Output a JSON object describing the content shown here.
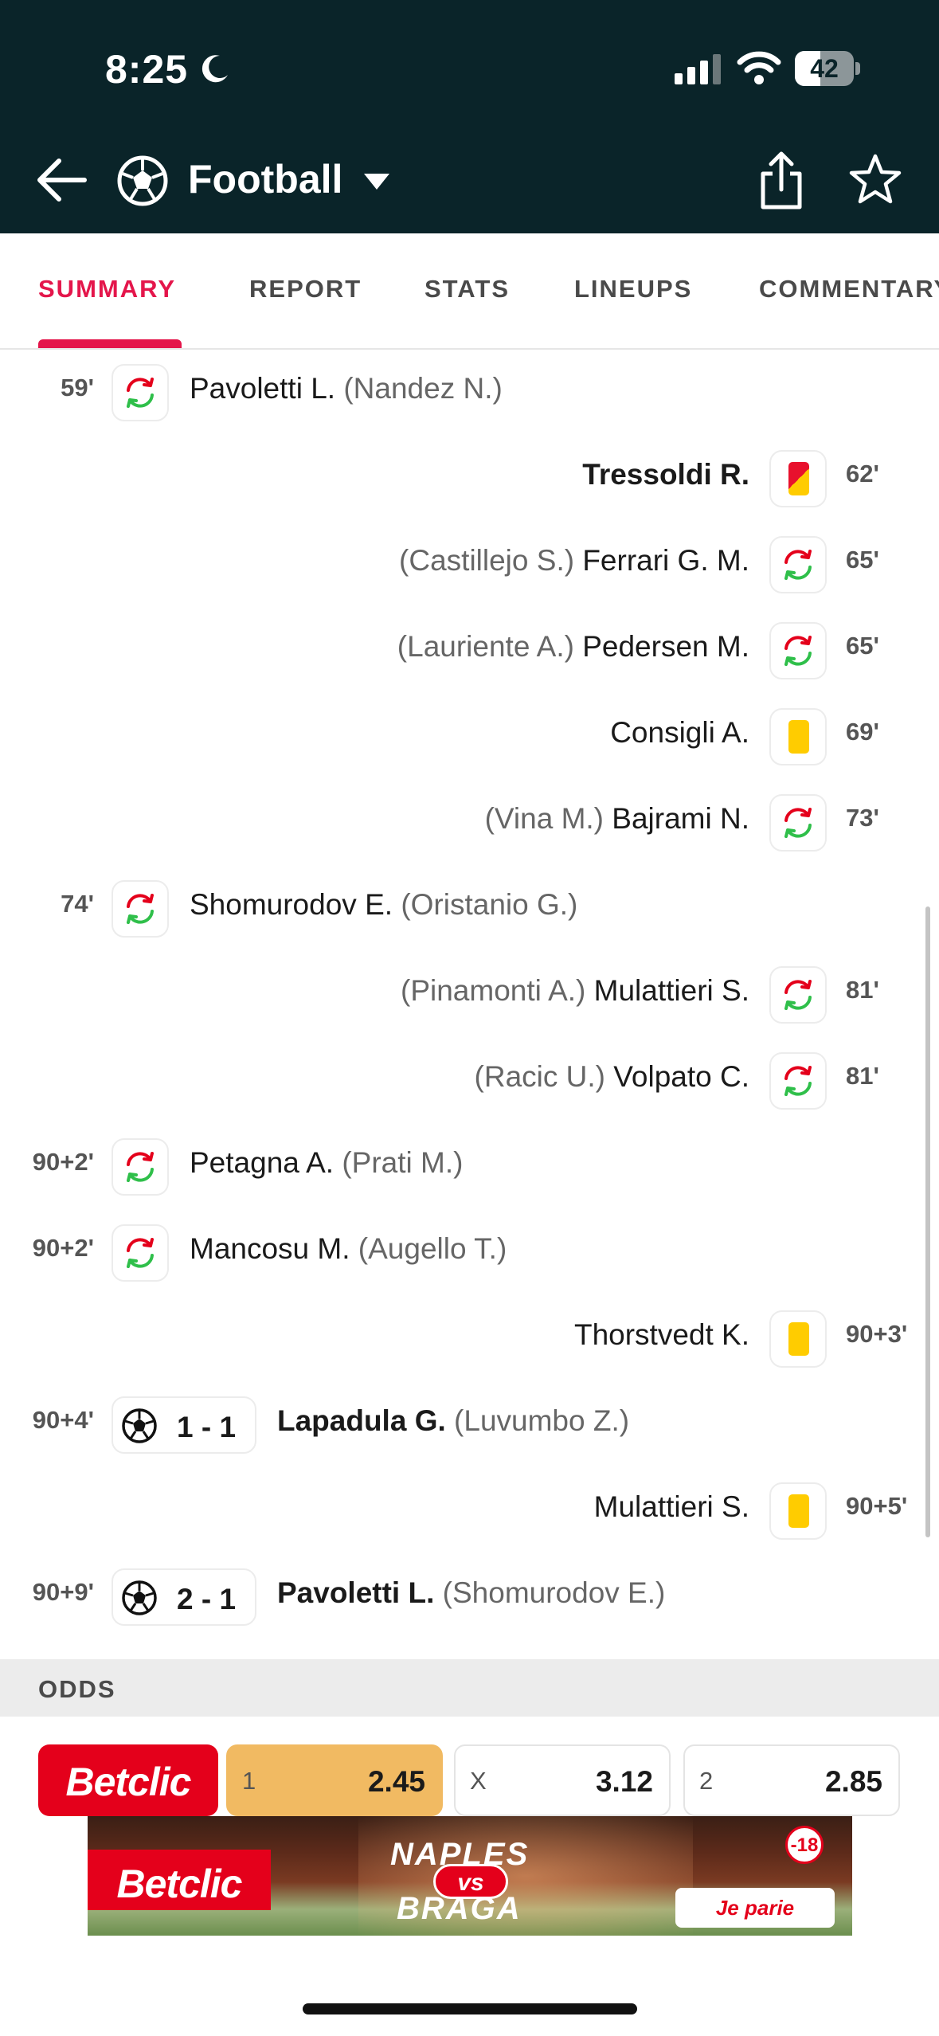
{
  "status_bar": {
    "time": "8:25",
    "battery": "42"
  },
  "header": {
    "title": "Football"
  },
  "tabs": [
    {
      "label": "SUMMARY"
    },
    {
      "label": "REPORT"
    },
    {
      "label": "STATS"
    },
    {
      "label": "LINEUPS"
    },
    {
      "label": "COMMENTARY"
    }
  ],
  "events": [
    {
      "side": "left",
      "type": "substitution",
      "minute": "59'",
      "player": "Pavoletti L.",
      "sub": "(Nandez N.)"
    },
    {
      "side": "right",
      "type": "second-yellow",
      "minute": "62'",
      "player": "Tressoldi R.",
      "sub": ""
    },
    {
      "side": "right",
      "type": "substitution",
      "minute": "65'",
      "player": "Ferrari G. M.",
      "sub": "(Castillejo S.)"
    },
    {
      "side": "right",
      "type": "substitution",
      "minute": "65'",
      "player": "Pedersen M.",
      "sub": "(Lauriente A.)"
    },
    {
      "side": "right",
      "type": "yellow-card",
      "minute": "69'",
      "player": "Consigli A.",
      "sub": ""
    },
    {
      "side": "right",
      "type": "substitution",
      "minute": "73'",
      "player": "Bajrami N.",
      "sub": "(Vina M.)"
    },
    {
      "side": "left",
      "type": "substitution",
      "minute": "74'",
      "player": "Shomurodov E.",
      "sub": "(Oristanio G.)"
    },
    {
      "side": "right",
      "type": "substitution",
      "minute": "81'",
      "player": "Mulattieri S.",
      "sub": "(Pinamonti A.)"
    },
    {
      "side": "right",
      "type": "substitution",
      "minute": "81'",
      "player": "Volpato C.",
      "sub": "(Racic U.)"
    },
    {
      "side": "left",
      "type": "substitution",
      "minute": "90+2'",
      "player": "Petagna A.",
      "sub": "(Prati M.)"
    },
    {
      "side": "left",
      "type": "substitution",
      "minute": "90+2'",
      "player": "Mancosu M.",
      "sub": "(Augello T.)"
    },
    {
      "side": "right",
      "type": "yellow-card",
      "minute": "90+3'",
      "player": "Thorstvedt K.",
      "sub": ""
    },
    {
      "side": "left",
      "type": "goal",
      "minute": "90+4'",
      "score": "1 - 1",
      "player": "Lapadula G.",
      "sub": "(Luvumbo Z.)"
    },
    {
      "side": "right",
      "type": "yellow-card",
      "minute": "90+5'",
      "player": "Mulattieri S.",
      "sub": ""
    },
    {
      "side": "left",
      "type": "goal",
      "minute": "90+9'",
      "score": "2 - 1",
      "player": "Pavoletti L.",
      "sub": "(Shomurodov E.)"
    }
  ],
  "odds": {
    "title": "ODDS",
    "bookmaker": "Betclic",
    "items": [
      {
        "label": "1",
        "value": "2.45",
        "selected": true
      },
      {
        "label": "X",
        "value": "3.12",
        "selected": false
      },
      {
        "label": "2",
        "value": "2.85",
        "selected": false
      }
    ]
  },
  "banner": {
    "brand": "Betclic",
    "team_home": "NAPLES",
    "vs": "vs",
    "team_away": "BRAGA",
    "age": "-18",
    "cta": "Je parie"
  },
  "colors": {
    "header_bg": "#0a2429",
    "accent": "#e4164b",
    "odds_selected": "#f1ba62",
    "brand_red": "#e4001b"
  }
}
